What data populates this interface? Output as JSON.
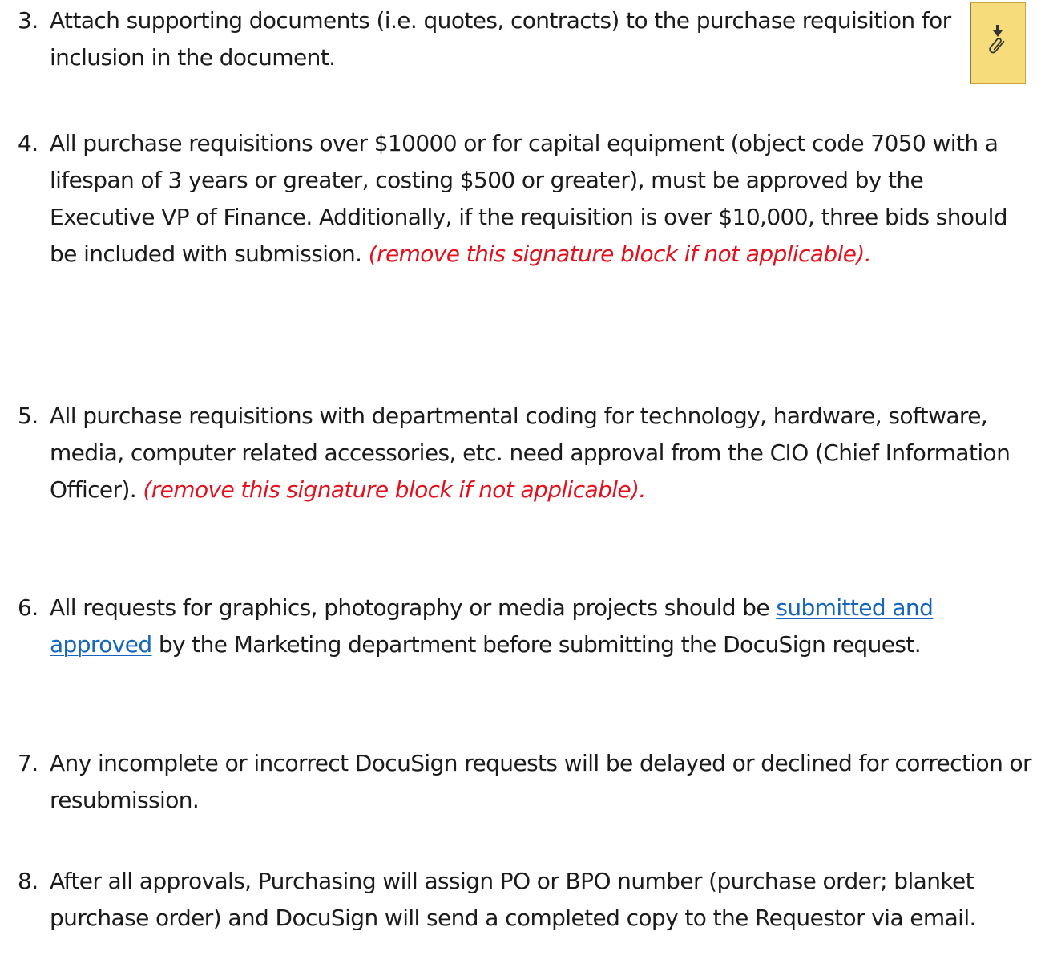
{
  "items": [
    {
      "number": "3.",
      "text": "Attach supporting documents (i.e. quotes, contracts) to the purchase requisition for inclusion in the document."
    },
    {
      "number": "4.",
      "text": "All purchase requisitions over $10000 or for capital equipment (object code 7050 with a lifespan of 3 years or greater, costing $500 or greater), must be approved by the Executive VP of Finance. Additionally, if the requisition is over $10,000, three bids should be included with submission. ",
      "note": "(remove this signature block if not applicable)."
    },
    {
      "number": "5.",
      "text": "All purchase requisitions with departmental coding for technology, hardware, software, media, computer related accessories, etc. need approval from the CIO (Chief Information Officer).  ",
      "note": "(remove this signature block if not applicable)."
    },
    {
      "number": "6.",
      "text_before": "All requests for graphics, photography or media projects should be ",
      "link": "submitted and approved",
      "text_after": " by the Marketing department before submitting the DocuSign request."
    },
    {
      "number": "7.",
      "text": "Any incomplete or incorrect DocuSign requests will be delayed or declined for correction or resubmission."
    },
    {
      "number": "8.",
      "text": "After all approvals, Purchasing will assign PO or BPO number (purchase order; blanket purchase order) and DocuSign will send a completed copy to the Requestor via email."
    }
  ],
  "attachment_tag": {
    "icon": "download-attachment-icon",
    "color": "#f6dc7a"
  }
}
